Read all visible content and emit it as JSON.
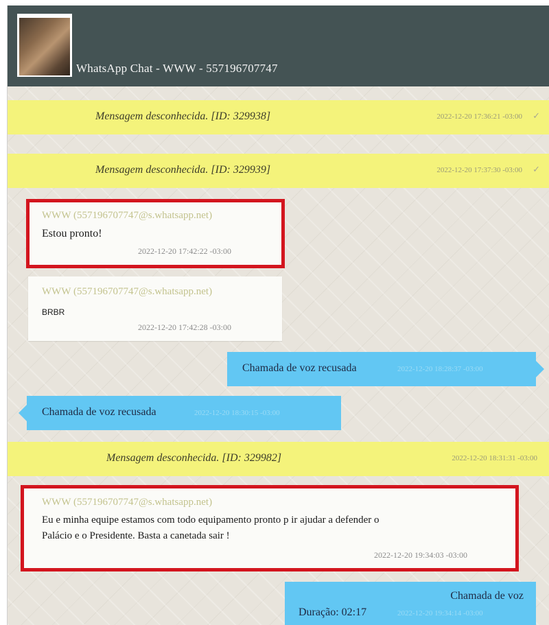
{
  "header": {
    "title": "WhatsApp Chat - WWW - 557196707747",
    "avatar_icon": "contact-photo"
  },
  "colors": {
    "header_bg": "#445354",
    "system_bar": "#f4f37b",
    "voice_call_bubble": "#62c7f3",
    "highlight_box": "#d3151e"
  },
  "messages": [
    {
      "type": "system",
      "text": "Mensagem desconhecida. [ID: 329938]",
      "timestamp": "2022-12-20 17:36:21 -03:00",
      "status_icon": "check-icon"
    },
    {
      "type": "system",
      "text": "Mensagem desconhecida. [ID: 329939]",
      "timestamp": "2022-12-20 17:37:30 -03:00",
      "status_icon": "check-icon"
    },
    {
      "type": "incoming",
      "sender": "WWW (557196707747@s.whatsapp.net)",
      "text": "Estou pronto!",
      "timestamp": "2022-12-20 17:42:22 -03:00",
      "highlighted": true
    },
    {
      "type": "incoming",
      "sender": "WWW (557196707747@s.whatsapp.net)",
      "text": "BRBR",
      "timestamp": "2022-12-20 17:42:28 -03:00",
      "highlighted": false
    },
    {
      "type": "call_outgoing",
      "text": "Chamada de voz recusada",
      "timestamp": "2022-12-20 18:28:37 -03:00"
    },
    {
      "type": "call_incoming",
      "text": "Chamada de voz recusada",
      "timestamp": "2022-12-20 18:30:15 -03:00"
    },
    {
      "type": "system",
      "text": "Mensagem desconhecida. [ID: 329982]",
      "timestamp": "2022-12-20 18:31:31 -03:00"
    },
    {
      "type": "incoming",
      "sender": "WWW (557196707747@s.whatsapp.net)",
      "text_line1": "Eu e minha equipe estamos com todo equipamento pronto p ir ajudar a defender o",
      "text_line2": "Palácio e o Presidente. Basta a canetada sair !",
      "timestamp": "2022-12-20 19:34:03 -03:00",
      "highlighted": true
    },
    {
      "type": "call_outgoing",
      "text_line1": "Chamada de voz",
      "text_line2": "Duração: 02:17",
      "timestamp": "2022-12-20 19:34:14 -03:00"
    }
  ]
}
